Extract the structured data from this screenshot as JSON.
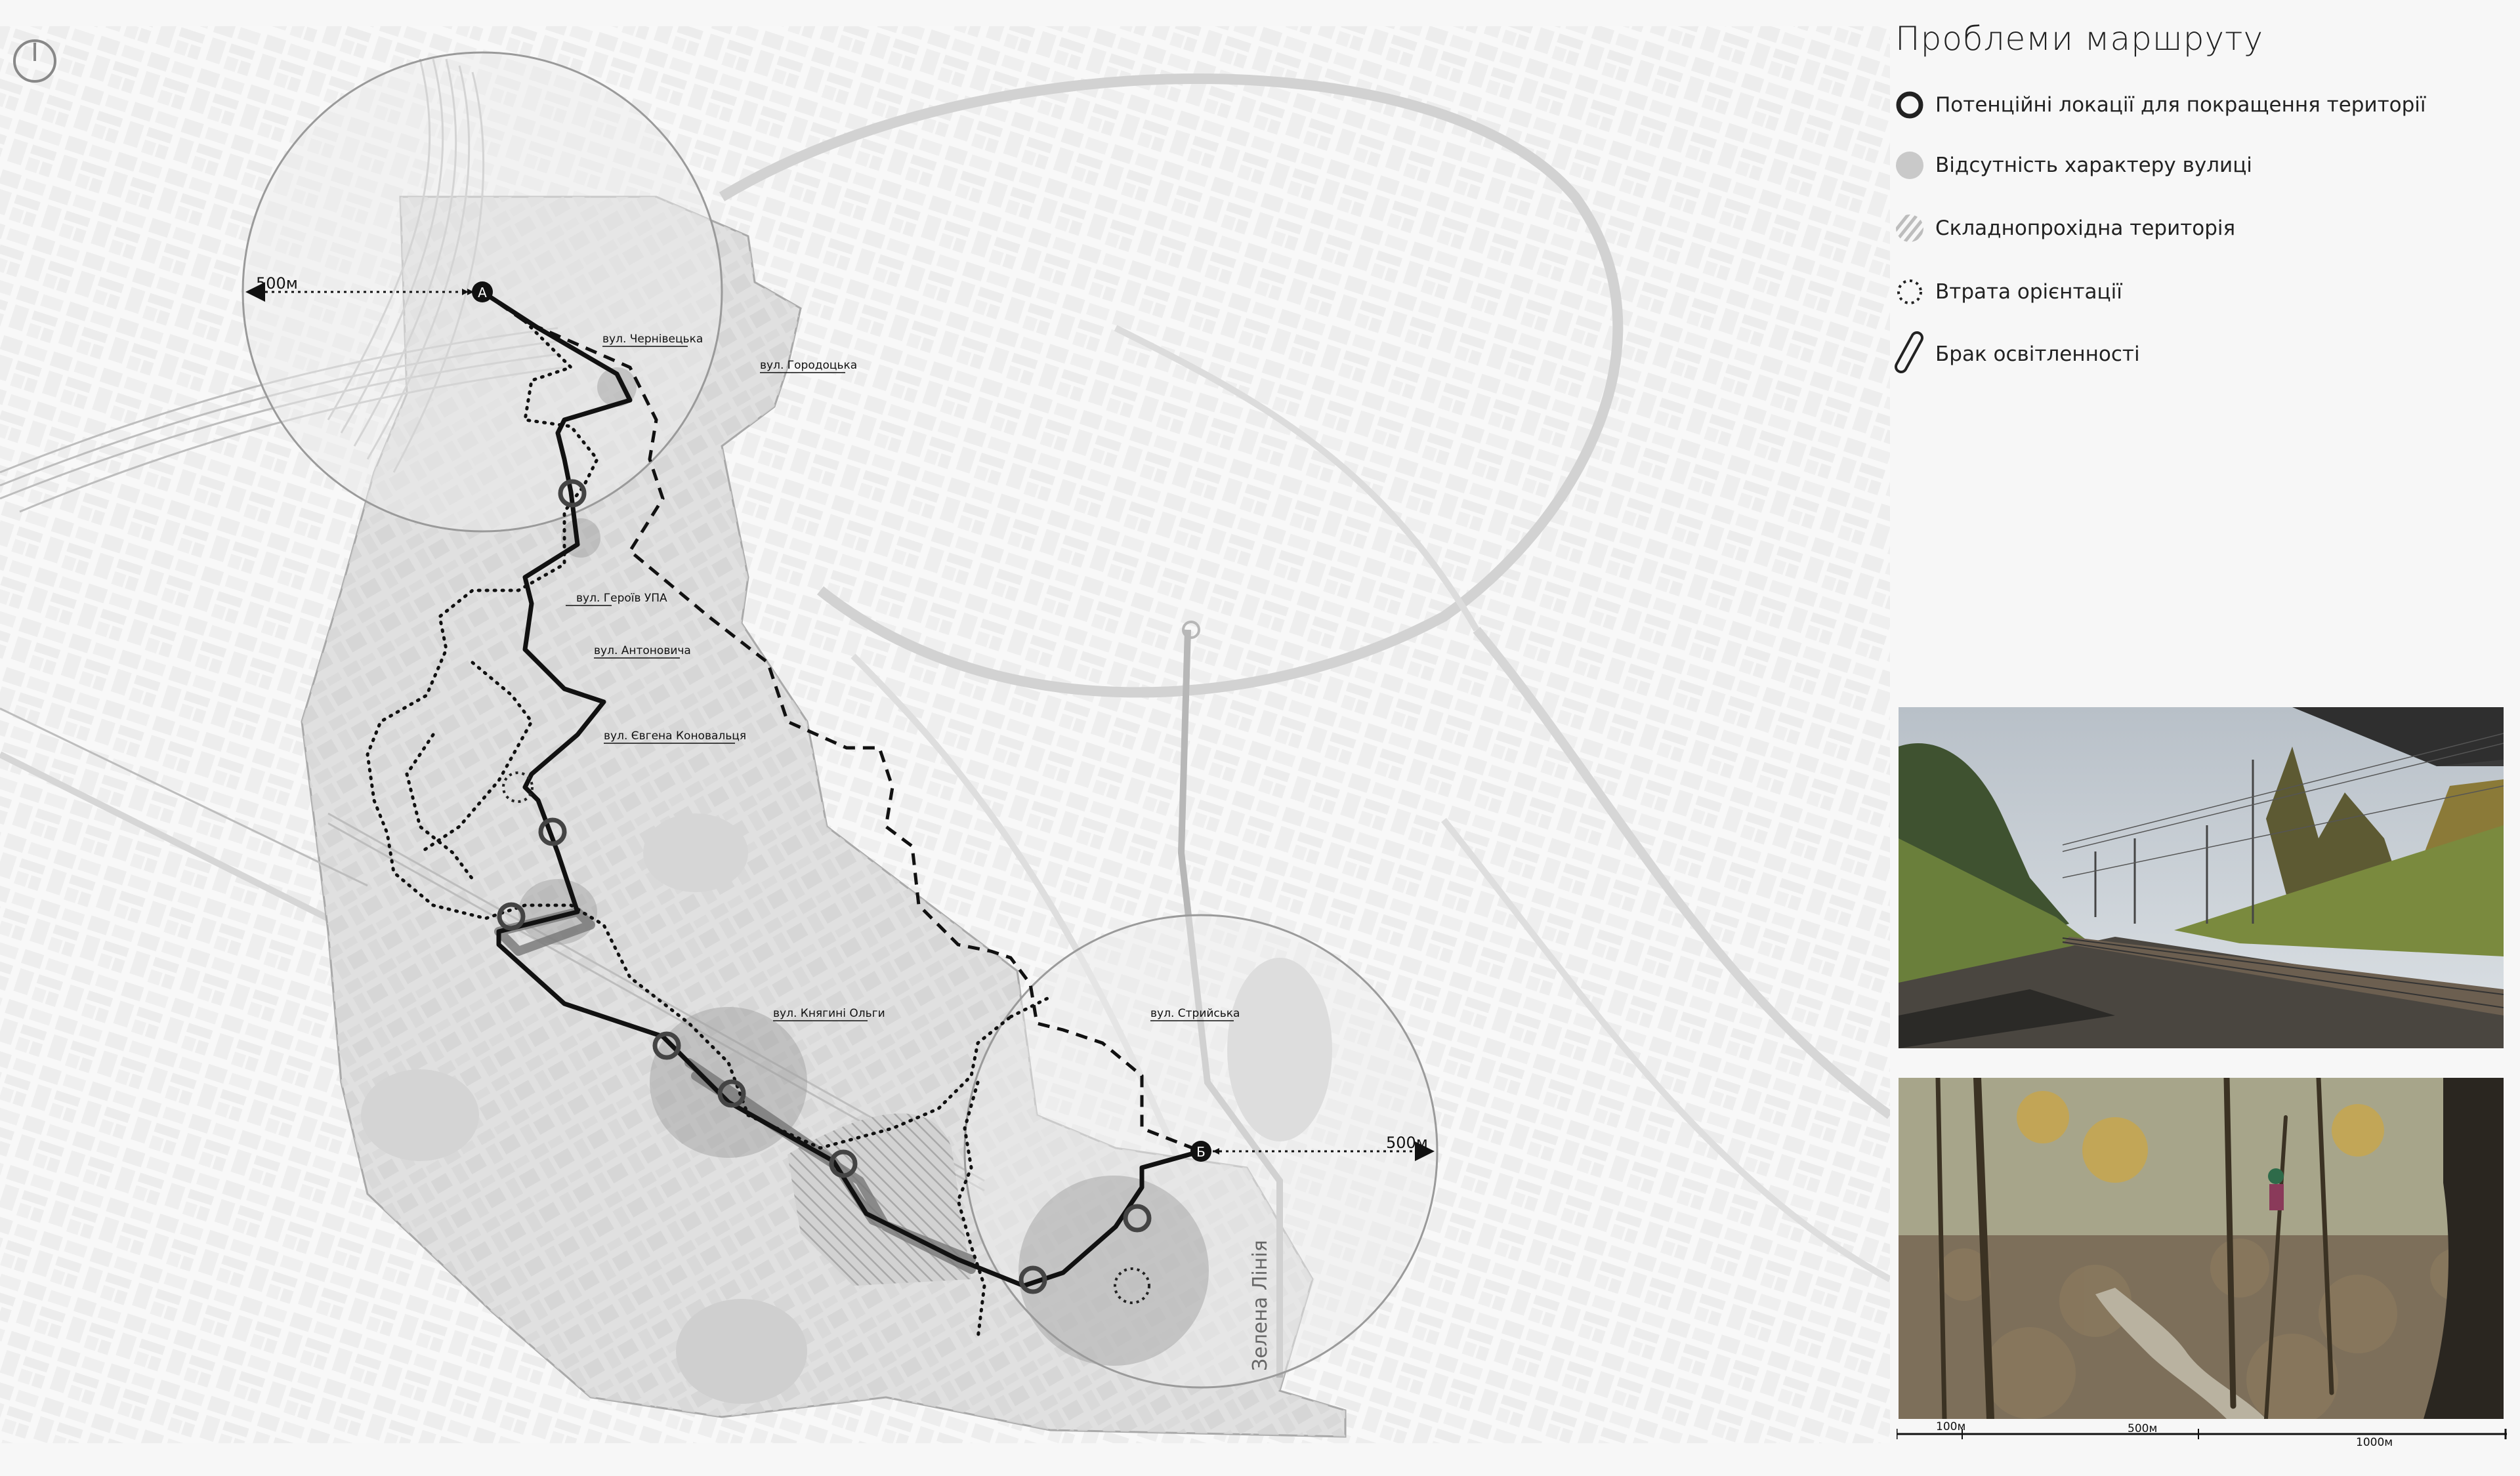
{
  "legend": {
    "title": "Проблеми маршруту",
    "items": [
      {
        "label": "Потенційні локації для покращення території",
        "icon": "ring-icon"
      },
      {
        "label": "Відсутність характеру вулиці",
        "icon": "gray-dot-icon"
      },
      {
        "label": "Складнопрохідна територія",
        "icon": "hatched-dot-icon"
      },
      {
        "label": "Втрата орієнтації",
        "icon": "dotted-circle-icon"
      },
      {
        "label": "Брак освітленності",
        "icon": "pill-outline-icon"
      }
    ]
  },
  "map": {
    "start_marker": "А",
    "end_marker": "Б",
    "radius_label_start": "500м",
    "radius_label_end": "500м",
    "green_line_label": "Зелена Лінія",
    "street_labels": [
      "вул. Чернівецька",
      "вул. Городоцька",
      "вул. Героїв УПА",
      "вул. Антоновича",
      "вул. Євгена Коновальця",
      "вул. Княгині Ольги",
      "вул. Стрийська"
    ]
  },
  "photos": [
    {
      "name": "railway-photo",
      "kind": "railway track with embankments"
    },
    {
      "name": "forest-stream-photo",
      "kind": "autumn forest stream"
    }
  ],
  "scale_bar": {
    "labels": [
      "100м",
      "500м",
      "1000м"
    ]
  },
  "colors": {
    "route_main": "#111111",
    "route_alt": "#111111",
    "circles": "#9a9a9a",
    "buildings": "#e4e4e4",
    "area_fill": "#dcdcdc"
  }
}
